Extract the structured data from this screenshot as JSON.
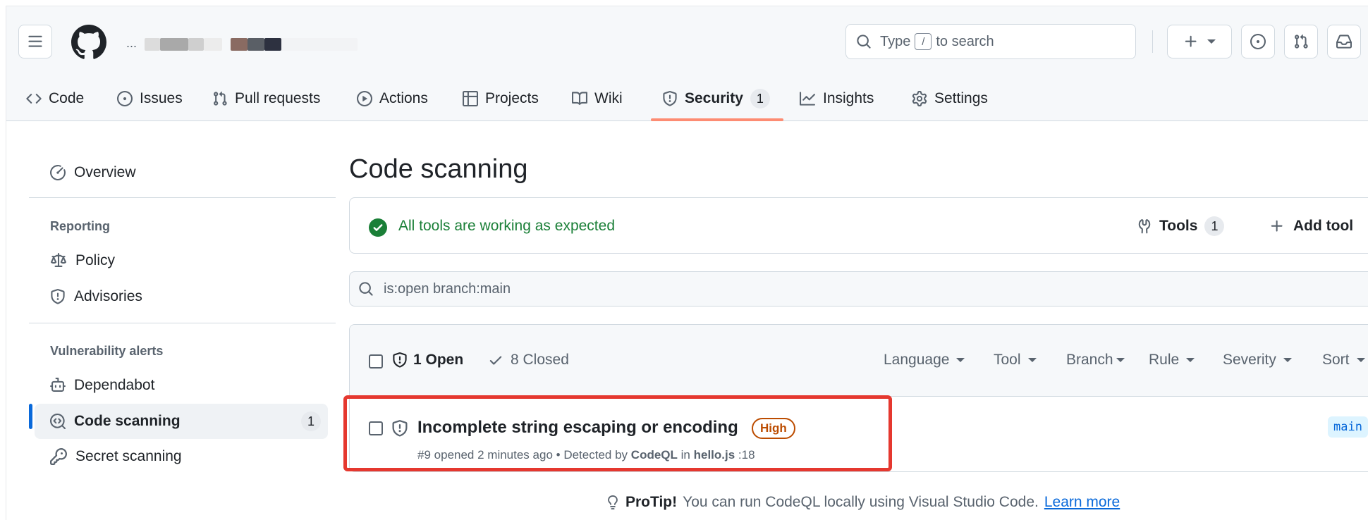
{
  "header": {
    "search_prefix": "Type",
    "search_kbd": "/",
    "search_suffix": "to search",
    "owner_ellipsis": "..."
  },
  "repo_nav": {
    "tabs": [
      {
        "label": "Code",
        "icon": "code-icon"
      },
      {
        "label": "Issues",
        "icon": "issue-opened-icon"
      },
      {
        "label": "Pull requests",
        "icon": "git-pull-request-icon"
      },
      {
        "label": "Actions",
        "icon": "play-icon"
      },
      {
        "label": "Projects",
        "icon": "table-icon"
      },
      {
        "label": "Wiki",
        "icon": "book-icon"
      },
      {
        "label": "Security",
        "icon": "shield-icon",
        "count": "1",
        "selected": true
      },
      {
        "label": "Insights",
        "icon": "graph-icon"
      },
      {
        "label": "Settings",
        "icon": "gear-icon"
      }
    ]
  },
  "sidebar": {
    "overview": "Overview",
    "reporting_heading": "Reporting",
    "policy": "Policy",
    "advisories": "Advisories",
    "vuln_heading": "Vulnerability alerts",
    "dependabot": "Dependabot",
    "code_scanning": "Code scanning",
    "code_scanning_count": "1",
    "secret_scanning": "Secret scanning"
  },
  "main": {
    "title": "Code scanning",
    "status_text": "All tools are working as expected",
    "tools_label": "Tools",
    "tools_count": "1",
    "add_tool": "Add tool",
    "filter_value": "is:open branch:main",
    "open_label": "1 Open",
    "closed_label": "8 Closed",
    "filters": [
      "Language",
      "Tool",
      "Branch",
      "Rule",
      "Severity",
      "Sort"
    ],
    "alert": {
      "title": "Incomplete string escaping or encoding",
      "severity": "High",
      "number": "#9",
      "opened": "opened 2 minutes ago",
      "detected_by_prefix": "Detected by",
      "tool": "CodeQL",
      "in_word": "in",
      "file": "hello.js",
      "line": ":18",
      "branch": "main"
    },
    "protip_label": "ProTip!",
    "protip_text": "You can run CodeQL locally using Visual Studio Code.",
    "learn_more": "Learn more"
  },
  "colors": {
    "accent": "#0969da",
    "success": "#1a7f37",
    "severity_high": "#bc4c00",
    "tab_underline": "#fd8c73",
    "highlight": "#e5382f"
  }
}
